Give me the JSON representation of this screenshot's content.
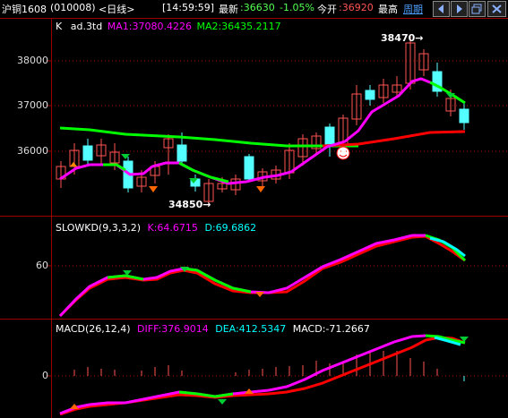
{
  "header": {
    "instrument": "沪铜1608",
    "code": "(010008)",
    "period": "<日线>",
    "time": "[14:59:59]",
    "latest_label": "最新",
    "latest_value": ":36630",
    "change_pct": "-1.05%",
    "open_label": "今开",
    "open_value": ":36920",
    "high_label": "最高",
    "cycle_label": "周期"
  },
  "main": {
    "k_label": "K",
    "indicator_name": "ad.3td",
    "ma1": "MA1:37080.4226",
    "ma2": "MA2:36435.2117",
    "y_labels": [
      "38000",
      "37000",
      "36000"
    ],
    "high_annotation": "38470",
    "low_annotation": "34850"
  },
  "kd": {
    "name": "SLOWKD(9,3,3,2)",
    "k": "K:64.6715",
    "d": "D:69.6862",
    "y_label": "60"
  },
  "macd": {
    "name": "MACD(26,12,4)",
    "diff": "DIFF:376.9014",
    "dea": "DEA:412.5347",
    "macd": "MACD:-71.2667",
    "y_label": "0"
  },
  "colors": {
    "up": "#ff5454",
    "down": "#54ffff",
    "ma1": "#ff00ff",
    "ma2": "#00ff00",
    "axis": "#9b0000"
  }
}
